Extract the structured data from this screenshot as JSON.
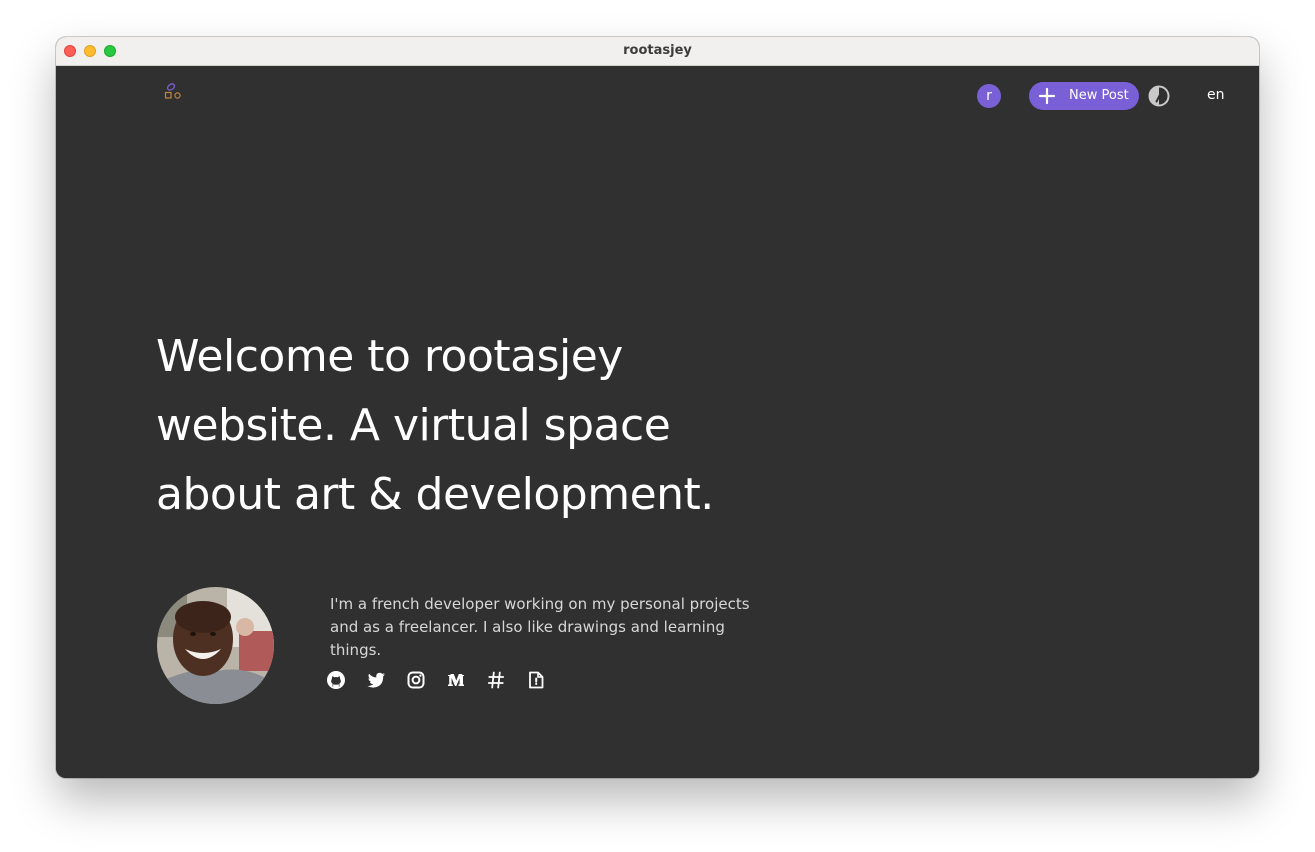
{
  "window": {
    "title": "rootasjey"
  },
  "header": {
    "user_initial": "r",
    "new_post_label": "New Post",
    "language": "en"
  },
  "hero": {
    "headline": "Welcome to rootasjey website. A virtual space about art & development."
  },
  "about": {
    "bio": "I'm a french developer working on my personal projects and as a freelancer. I also like drawings and learning things."
  },
  "social_links": [
    {
      "icon": "github-icon"
    },
    {
      "icon": "twitter-icon"
    },
    {
      "icon": "instagram-icon"
    },
    {
      "icon": "medium-icon"
    },
    {
      "icon": "hashtag-icon"
    },
    {
      "icon": "resume-file-icon"
    }
  ],
  "colors": {
    "background": "#303030",
    "accent": "#7a60d6",
    "text": "#ffffff",
    "muted_text": "#d7d7d7"
  }
}
